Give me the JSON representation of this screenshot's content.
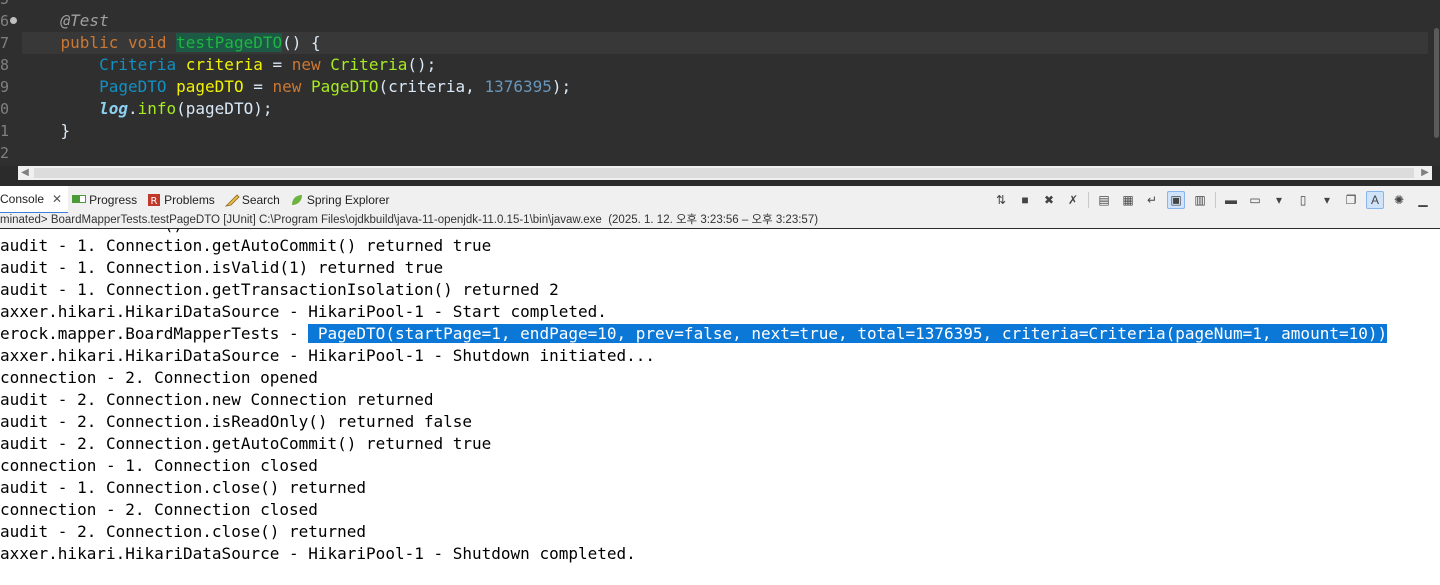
{
  "editor": {
    "line_numbers": [
      "5",
      "6",
      "7",
      "8",
      "9",
      "0",
      "1",
      "2"
    ],
    "code": {
      "annotation": "@Test",
      "l7_kw1": "public",
      "l7_kw2": "void",
      "l7_method": "testPageDTO",
      "l7_rest": "() {",
      "l8_type": "Criteria",
      "l8_var": "criteria",
      "l8_eq": " = ",
      "l8_new": "new",
      "l8_ctor": "Criteria",
      "l8_end": "();",
      "l9_type": "PageDTO",
      "l9_var": "pageDTO",
      "l9_eq": " = ",
      "l9_new": "new",
      "l9_ctor": "PageDTO",
      "l9_args": "(criteria, ",
      "l9_num": "1376395",
      "l9_end": ");",
      "l10_log": "log",
      "l10_dot": ".",
      "l10_meth": "info",
      "l10_args": "(pageDTO);",
      "l11": "}"
    }
  },
  "tabs": {
    "console": "Console",
    "progress": "Progress",
    "problems": "Problems",
    "search": "Search",
    "spring": "Spring Explorer"
  },
  "launch_info": "minated> BoardMapperTests.testPageDTO [JUnit] C:\\Program Files\\ojdkbuild\\java-11-openjdk-11.0.15-1\\bin\\javaw.exe  (2025. 1. 12. 오후 3:23:56 – 오후 3:23:57)",
  "console": {
    "partial_top": "                 ()",
    "lines": [
      "audit - 1. Connection.getAutoCommit() returned true",
      "audit - 1. Connection.isValid(1) returned true",
      "audit - 1. Connection.getTransactionIsolation() returned 2",
      "axxer.hikari.HikariDataSource - HikariPool-1 - Start completed.",
      "erock.mapper.BoardMapperTests - ",
      "axxer.hikari.HikariDataSource - HikariPool-1 - Shutdown initiated...",
      "connection - 2. Connection opened",
      "audit - 2. Connection.new Connection returned",
      "audit - 2. Connection.isReadOnly() returned false",
      "audit - 2. Connection.getAutoCommit() returned true",
      "connection - 1. Connection closed",
      "audit - 1. Connection.close() returned",
      "connection - 2. Connection closed",
      "audit - 2. Connection.close() returned",
      "axxer.hikari.HikariDataSource - HikariPool-1 - Shutdown completed."
    ],
    "selected": " PageDTO(startPage=1, endPage=10, prev=false, next=true, total=1376395, criteria=Criteria(pageNum=1, amount=10))"
  },
  "colors": {
    "selection": "#0b78d7",
    "editor_bg": "#2f2f2f",
    "keyword": "#cc7832"
  },
  "icons": [
    "progress-icon",
    "problems-icon",
    "search-icon",
    "spring-icon",
    "sync-icon",
    "stop-icon",
    "remove-icon",
    "remove-all-icon",
    "clear-console-icon",
    "scroll-lock-icon",
    "word-wrap-icon",
    "show-when-stdout-icon",
    "show-when-stderr-icon",
    "pin-console-icon",
    "display-console-icon",
    "new-console-icon",
    "open-console-icon",
    "copy-icon",
    "highlight-icon",
    "settings-icon",
    "minimize-icon"
  ]
}
